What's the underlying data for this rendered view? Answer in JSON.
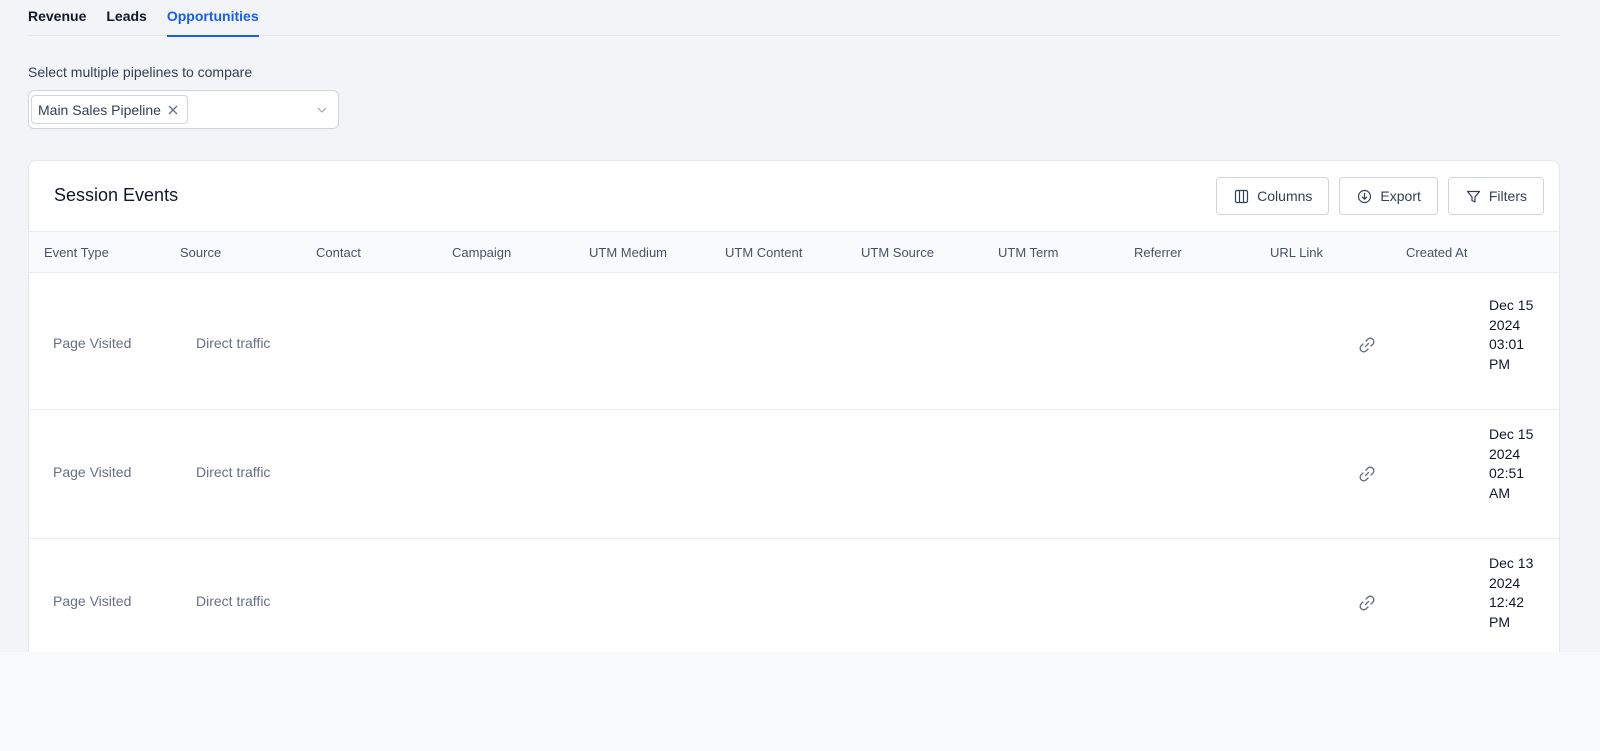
{
  "tabs": [
    {
      "label": "Revenue"
    },
    {
      "label": "Leads"
    },
    {
      "label": "Opportunities"
    }
  ],
  "active_tab": "Opportunities",
  "pipeline_selector": {
    "label": "Select multiple pipelines to compare",
    "selected": [
      "Main Sales Pipeline"
    ]
  },
  "card": {
    "title": "Session Events",
    "buttons": {
      "columns": "Columns",
      "export": "Export",
      "filters": "Filters"
    }
  },
  "table": {
    "columns": [
      "Event Type",
      "Source",
      "Contact",
      "Campaign",
      "UTM Medium",
      "UTM Content",
      "UTM Source",
      "UTM Term",
      "Referrer",
      "URL Link",
      "Created At"
    ],
    "rows": [
      {
        "event_type": "Page Visited",
        "source": "Direct traffic",
        "created_at": "Dec 15 2024 03:01 PM"
      },
      {
        "event_type": "Page Visited",
        "source": "Direct traffic",
        "created_at": "Dec 15 2024 02:51 AM"
      },
      {
        "event_type": "Page Visited",
        "source": "Direct traffic",
        "created_at": "Dec 13 2024 12:42 PM"
      }
    ]
  },
  "icons": {
    "chip_remove": "close-icon",
    "select_chevron": "chevron-down-icon",
    "columns": "columns-icon",
    "export": "export-icon",
    "filters": "filter-icon",
    "url_link": "link-icon"
  },
  "colors": {
    "accent": "#155eef",
    "page_bg": "#f2f4f7",
    "card_bg": "#ffffff"
  }
}
